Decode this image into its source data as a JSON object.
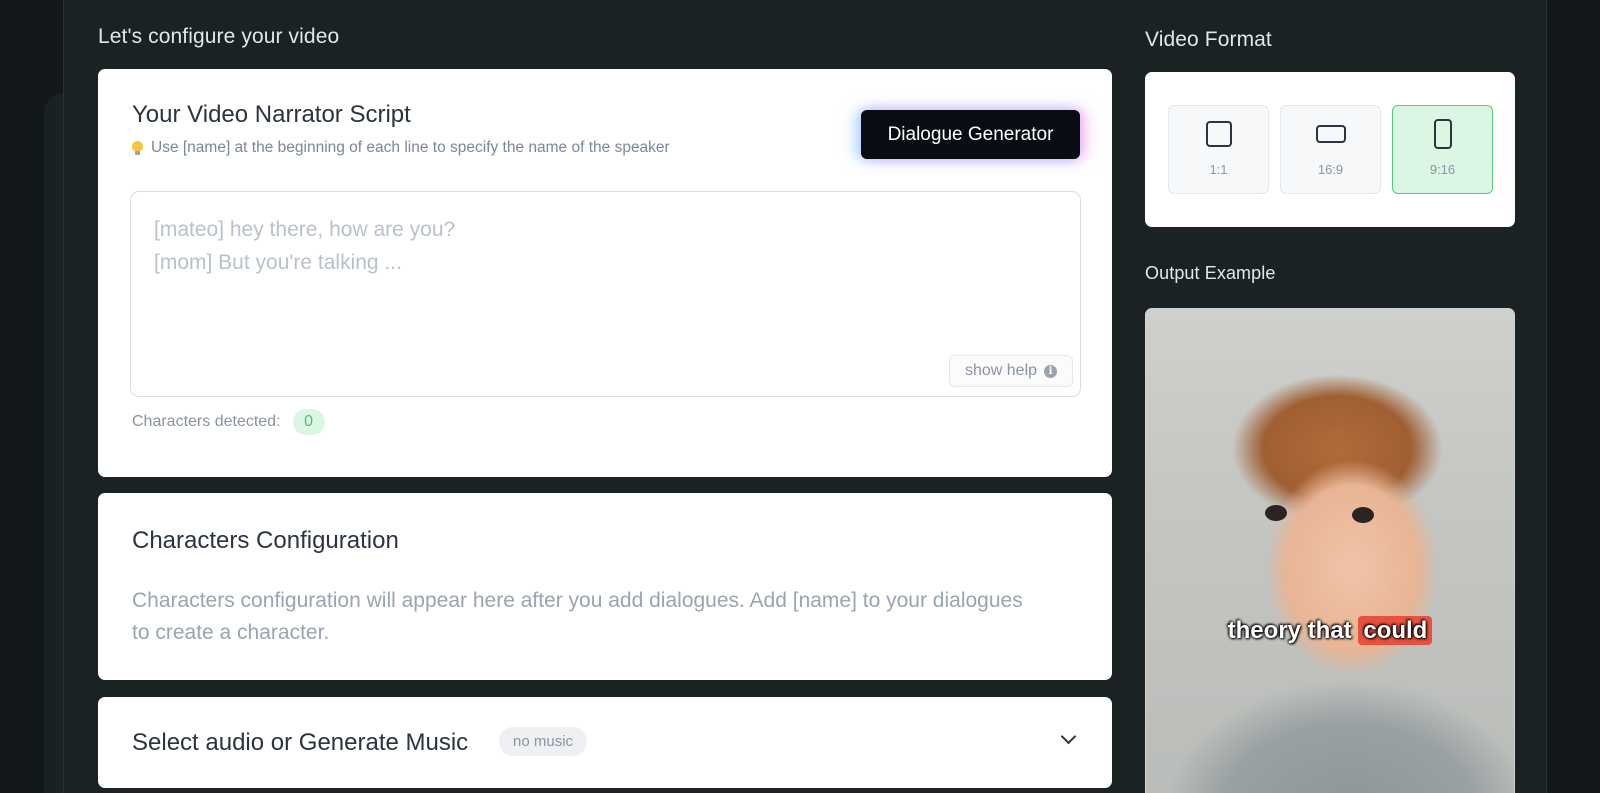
{
  "headings": {
    "configure": "Let's configure your video",
    "video_format": "Video Format",
    "output_example": "Output Example"
  },
  "script_card": {
    "title": "Your Video Narrator Script",
    "tip": "Use [name] at the beginning of each line to specify the name of the speaker",
    "dialogue_button": "Dialogue Generator",
    "placeholder_line1": "[mateo] hey there, how are you?",
    "placeholder_line2": "[mom] But you're talking ...",
    "show_help": "show help",
    "characters_detected_label": "Characters detected:",
    "characters_detected_count": "0"
  },
  "characters_card": {
    "title": "Characters Configuration",
    "description": "Characters configuration will appear here after you add dialogues. Add [name] to your dialogues to create a character."
  },
  "audio_card": {
    "title": "Select audio or Generate Music",
    "badge": "no music"
  },
  "video_format": {
    "options": [
      {
        "label": "1:1",
        "selected": false
      },
      {
        "label": "16:9",
        "selected": false
      },
      {
        "label": "9:16",
        "selected": true
      }
    ]
  },
  "output_example": {
    "caption_plain": "theory that",
    "caption_highlight": "could"
  },
  "colors": {
    "background": "#121819",
    "panel": "#1b2223",
    "selected_format": "#dcf6e4",
    "caption_highlight": "#e8513e"
  }
}
